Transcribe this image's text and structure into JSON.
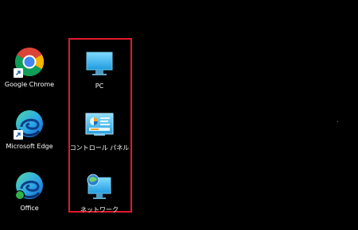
{
  "desktop": {
    "left_column": [
      {
        "label": "Google Chrome",
        "icon": "chrome-icon",
        "badge": "shortcut-arrow-icon"
      },
      {
        "label": "Microsoft Edge",
        "icon": "edge-icon",
        "badge": "shortcut-arrow-icon"
      },
      {
        "label": "Office",
        "icon": "office-edge-icon",
        "badge": "sync-check-icon"
      }
    ],
    "highlighted_column": [
      {
        "label": "PC",
        "icon": "pc-monitor-icon"
      },
      {
        "label": "コントロール パネル",
        "icon": "control-panel-icon"
      },
      {
        "label": "ネットワーク",
        "icon": "network-icon"
      }
    ]
  },
  "colors": {
    "background": "#000000",
    "highlight_border": "#e21a2a",
    "label_text": "#ffffff"
  }
}
